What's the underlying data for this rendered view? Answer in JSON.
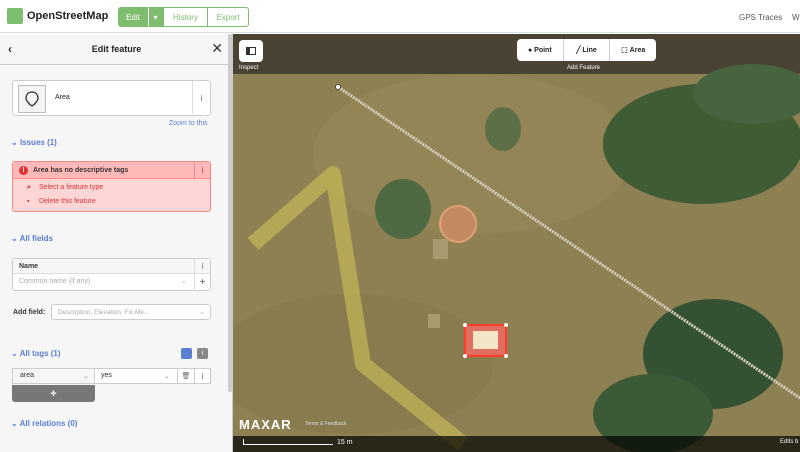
{
  "topbar": {
    "logo_text": "OpenStreetMap",
    "edit_label": "Edit",
    "edit_dropdown": "▾",
    "history_label": "History",
    "export_label": "Export",
    "gps_traces": "GPS Traces",
    "more": "W"
  },
  "sidebar": {
    "back": "‹",
    "title": "Edit feature",
    "close": "✕",
    "preset_name": "Area",
    "preset_info": "i",
    "zoom_to": "Zoom to this",
    "issues_header": "Issues (1)",
    "issue_text": "Area has no descriptive tags",
    "issue_bang": "!",
    "issue_info": "i",
    "fix_select": "Select a feature type",
    "fix_delete": "Delete this feature",
    "all_fields_header": "All fields",
    "name_label": "Name",
    "name_info": "i",
    "name_placeholder": "Common name (if any)",
    "name_caret": "⌄",
    "name_add": "+",
    "add_field_label": "Add field:",
    "add_field_placeholder": "Description, Elevation, Fix Me...",
    "add_field_caret": "⌄",
    "all_tags_header": "All tags (1)",
    "text_view_icon": "i",
    "tag_key": "area",
    "tag_value": "yes",
    "tag_caret": "⌄",
    "tag_delete": "🗑",
    "tag_info": "i",
    "tag_add": "+",
    "all_relations_header": "All relations (0)",
    "section_chevron": "⌄"
  },
  "map": {
    "inspect_label": "Inspect",
    "mode_point": "Point",
    "mode_line": "Line",
    "mode_area": "Area",
    "add_feature_label": "Add Feature",
    "imagery_brand": "MAXAR",
    "terms": "Terms & Feedback",
    "scale": "15 m",
    "edits": "Edits b",
    "colors": {
      "selected": "#e06e5f",
      "path": "#d8d0c0",
      "yellow": "#d6c95a"
    }
  }
}
